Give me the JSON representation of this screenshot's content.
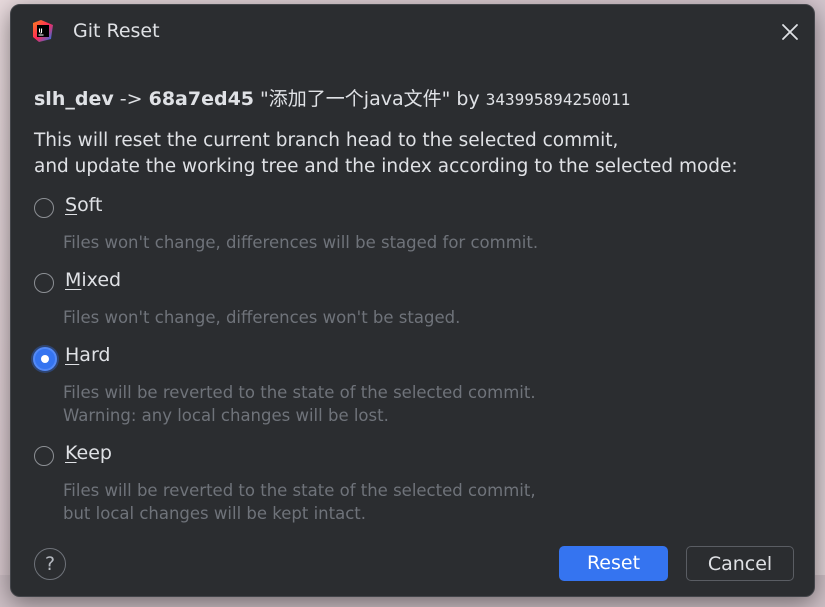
{
  "dialog": {
    "title": "Git Reset",
    "app_icon": "intellij-idea-icon",
    "close_icon": "close-icon"
  },
  "commit": {
    "branch": "slh_dev",
    "arrow": " -> ",
    "hash": "68a7ed45",
    "message": " \"添加了一个java文件\" ",
    "by": "by ",
    "author": "343995894250011"
  },
  "description": {
    "line1": "This will reset the current branch head to the selected commit,",
    "line2": "and update the working tree and the index according to the selected mode:"
  },
  "modes": [
    {
      "mnemonic": "S",
      "rest": "oft",
      "checked": false,
      "desc": [
        "Files won't change, differences will be staged for commit."
      ]
    },
    {
      "mnemonic": "M",
      "rest": "ixed",
      "checked": false,
      "desc": [
        "Files won't change, differences won't be staged."
      ]
    },
    {
      "mnemonic": "H",
      "rest": "ard",
      "checked": true,
      "desc": [
        "Files will be reverted to the state of the selected commit.",
        "Warning: any local changes will be lost."
      ]
    },
    {
      "mnemonic": "K",
      "rest": "eep",
      "checked": false,
      "desc": [
        "Files will be reverted to the state of the selected commit,",
        "but local changes will be kept intact."
      ]
    }
  ],
  "footer": {
    "help_label": "?",
    "reset_label": "Reset",
    "cancel_label": "Cancel"
  },
  "colors": {
    "background": "#2b2d30",
    "accent": "#3574f0",
    "text": "#dfe1e5",
    "muted_text": "#6f737a"
  }
}
